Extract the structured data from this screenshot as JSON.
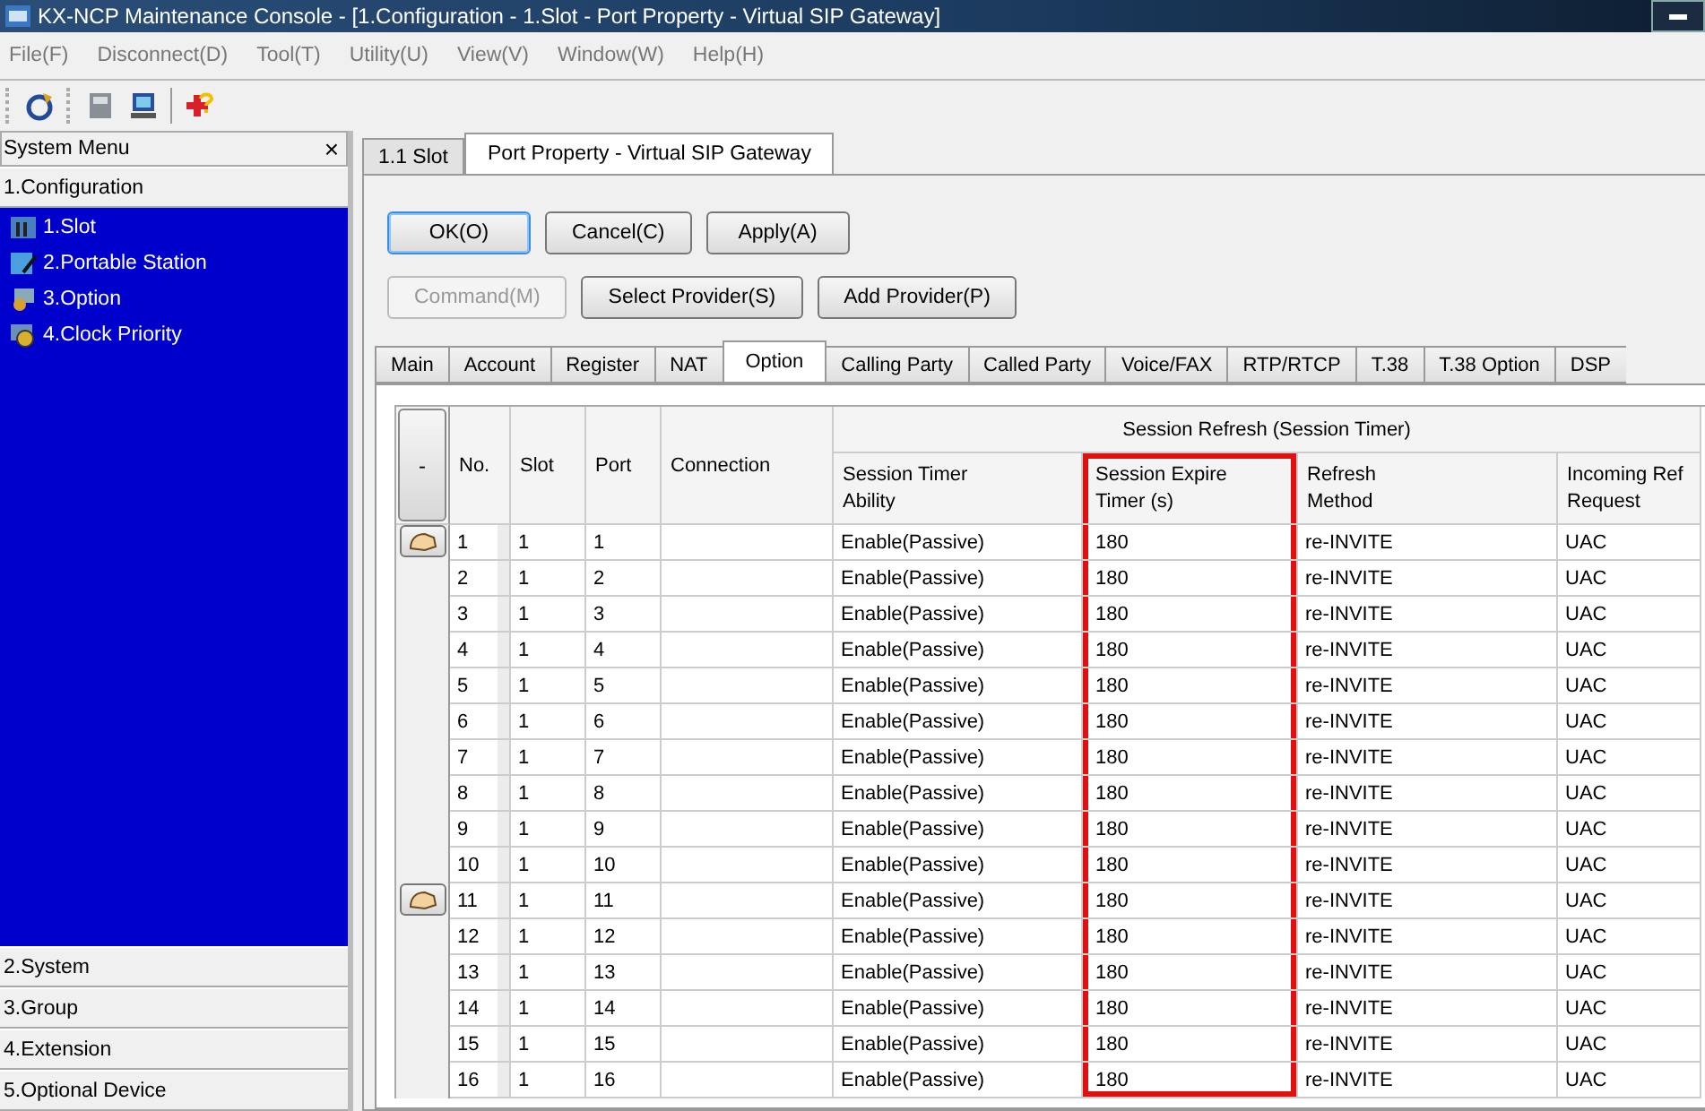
{
  "window": {
    "title": "KX-NCP Maintenance Console - [1.Configuration - 1.Slot - Port Property - Virtual SIP Gateway]"
  },
  "menu": [
    "File(F)",
    "Disconnect(D)",
    "Tool(T)",
    "Utility(U)",
    "View(V)",
    "Window(W)",
    "Help(H)"
  ],
  "sidebar": {
    "title": "System Menu",
    "close": "×",
    "sections": [
      {
        "label": "1.Configuration",
        "items": [
          "1.Slot",
          "2.Portable Station",
          "3.Option",
          "4.Clock Priority"
        ]
      },
      {
        "label": "2.System"
      },
      {
        "label": "3.Group"
      },
      {
        "label": "4.Extension"
      },
      {
        "label": "5.Optional Device"
      }
    ]
  },
  "doc_tabs": [
    {
      "label": "1.1 Slot",
      "selected": false
    },
    {
      "label": "Port Property - Virtual SIP Gateway",
      "selected": true
    }
  ],
  "button_rows": [
    [
      {
        "label": "OK(O)",
        "default": true,
        "disabled": false
      },
      {
        "label": "Cancel(C)",
        "default": false,
        "disabled": false
      },
      {
        "label": "Apply(A)",
        "default": false,
        "disabled": false
      }
    ],
    [
      {
        "label": "Command(M)",
        "default": false,
        "disabled": true
      },
      {
        "label": "Select Provider(S)",
        "default": false,
        "disabled": false
      },
      {
        "label": "Add Provider(P)",
        "default": false,
        "disabled": false
      }
    ]
  ],
  "tabs": [
    {
      "label": "Main",
      "selected": false
    },
    {
      "label": "Account",
      "selected": false
    },
    {
      "label": "Register",
      "selected": false
    },
    {
      "label": "NAT",
      "selected": false
    },
    {
      "label": "Option",
      "selected": true
    },
    {
      "label": "Calling Party",
      "selected": false
    },
    {
      "label": "Called Party",
      "selected": false
    },
    {
      "label": "Voice/FAX",
      "selected": false
    },
    {
      "label": "RTP/RTCP",
      "selected": false
    },
    {
      "label": "T.38",
      "selected": false
    },
    {
      "label": "T.38 Option",
      "selected": false
    },
    {
      "label": "DSP",
      "selected": false
    }
  ],
  "table": {
    "corner_button": "-",
    "columns": [
      {
        "label": "No."
      },
      {
        "label": "Slot"
      },
      {
        "label": "Port"
      },
      {
        "label": "Connection"
      }
    ],
    "groups": [
      {
        "label": "Session Refresh (Session Timer)",
        "columns": [
          {
            "label": "Session Timer\nAbility",
            "highlighted": false
          },
          {
            "label": "Session Expire\nTimer (s)",
            "highlighted": true
          },
          {
            "label": "Refresh\nMethod",
            "highlighted": false
          },
          {
            "label": "Incoming Ref\nRequest",
            "highlighted": false
          }
        ]
      }
    ],
    "rows": [
      {
        "group_start": true,
        "cells": [
          "1",
          "1",
          "1",
          null,
          "Enable(Passive)",
          "180",
          "re-INVITE",
          "UAC"
        ]
      },
      {
        "group_start": false,
        "cells": [
          "2",
          "1",
          "2",
          null,
          "Enable(Passive)",
          "180",
          "re-INVITE",
          "UAC"
        ]
      },
      {
        "group_start": false,
        "cells": [
          "3",
          "1",
          "3",
          null,
          "Enable(Passive)",
          "180",
          "re-INVITE",
          "UAC"
        ]
      },
      {
        "group_start": false,
        "cells": [
          "4",
          "1",
          "4",
          null,
          "Enable(Passive)",
          "180",
          "re-INVITE",
          "UAC"
        ]
      },
      {
        "group_start": false,
        "cells": [
          "5",
          "1",
          "5",
          null,
          "Enable(Passive)",
          "180",
          "re-INVITE",
          "UAC"
        ]
      },
      {
        "group_start": false,
        "cells": [
          "6",
          "1",
          "6",
          null,
          "Enable(Passive)",
          "180",
          "re-INVITE",
          "UAC"
        ]
      },
      {
        "group_start": false,
        "cells": [
          "7",
          "1",
          "7",
          null,
          "Enable(Passive)",
          "180",
          "re-INVITE",
          "UAC"
        ]
      },
      {
        "group_start": false,
        "cells": [
          "8",
          "1",
          "8",
          null,
          "Enable(Passive)",
          "180",
          "re-INVITE",
          "UAC"
        ]
      },
      {
        "group_start": false,
        "cells": [
          "9",
          "1",
          "9",
          null,
          "Enable(Passive)",
          "180",
          "re-INVITE",
          "UAC"
        ]
      },
      {
        "group_start": false,
        "cells": [
          "10",
          "1",
          "10",
          null,
          "Enable(Passive)",
          "180",
          "re-INVITE",
          "UAC"
        ]
      },
      {
        "group_start": true,
        "cells": [
          "11",
          "1",
          "11",
          null,
          "Enable(Passive)",
          "180",
          "re-INVITE",
          "UAC"
        ]
      },
      {
        "group_start": false,
        "cells": [
          "12",
          "1",
          "12",
          null,
          "Enable(Passive)",
          "180",
          "re-INVITE",
          "UAC"
        ]
      },
      {
        "group_start": false,
        "cells": [
          "13",
          "1",
          "13",
          null,
          "Enable(Passive)",
          "180",
          "re-INVITE",
          "UAC"
        ]
      },
      {
        "group_start": false,
        "cells": [
          "14",
          "1",
          "14",
          null,
          "Enable(Passive)",
          "180",
          "re-INVITE",
          "UAC"
        ]
      },
      {
        "group_start": false,
        "cells": [
          "15",
          "1",
          "15",
          null,
          "Enable(Passive)",
          "180",
          "re-INVITE",
          "UAC"
        ]
      },
      {
        "group_start": false,
        "cells": [
          "16",
          "1",
          "16",
          null,
          "Enable(Passive)",
          "180",
          "re-INVITE",
          "UAC"
        ]
      }
    ]
  }
}
